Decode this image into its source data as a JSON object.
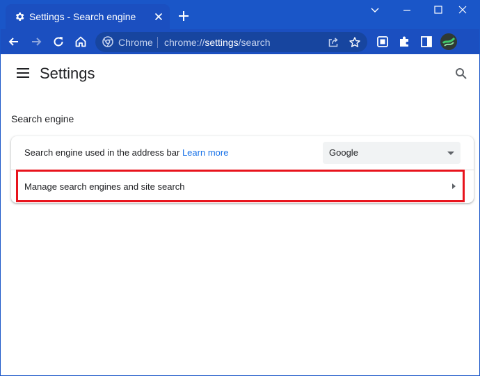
{
  "tab": {
    "title": "Settings - Search engine"
  },
  "address_bar": {
    "site_label": "Chrome",
    "url_scheme": "chrome://",
    "url_host": "settings",
    "url_path": "/search"
  },
  "header": {
    "title": "Settings"
  },
  "section": {
    "title": "Search engine"
  },
  "search_engine_row": {
    "label": "Search engine used in the address bar",
    "learn_more": "Learn more",
    "selected": "Google"
  },
  "manage_row": {
    "label": "Manage search engines and site search"
  },
  "colors": {
    "title_bar": "#1a56c8",
    "toolbar": "#1b4fc0",
    "link": "#1a73e8",
    "highlight": "#e8131c"
  }
}
